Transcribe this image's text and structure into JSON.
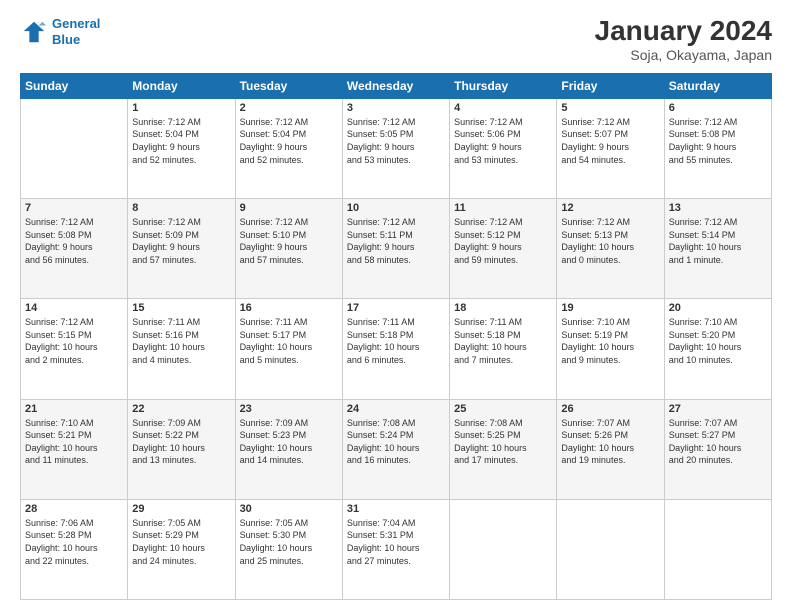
{
  "logo": {
    "line1": "General",
    "line2": "Blue"
  },
  "title": "January 2024",
  "subtitle": "Soja, Okayama, Japan",
  "headers": [
    "Sunday",
    "Monday",
    "Tuesday",
    "Wednesday",
    "Thursday",
    "Friday",
    "Saturday"
  ],
  "weeks": [
    [
      {
        "day": "",
        "info": ""
      },
      {
        "day": "1",
        "info": "Sunrise: 7:12 AM\nSunset: 5:04 PM\nDaylight: 9 hours\nand 52 minutes."
      },
      {
        "day": "2",
        "info": "Sunrise: 7:12 AM\nSunset: 5:04 PM\nDaylight: 9 hours\nand 52 minutes."
      },
      {
        "day": "3",
        "info": "Sunrise: 7:12 AM\nSunset: 5:05 PM\nDaylight: 9 hours\nand 53 minutes."
      },
      {
        "day": "4",
        "info": "Sunrise: 7:12 AM\nSunset: 5:06 PM\nDaylight: 9 hours\nand 53 minutes."
      },
      {
        "day": "5",
        "info": "Sunrise: 7:12 AM\nSunset: 5:07 PM\nDaylight: 9 hours\nand 54 minutes."
      },
      {
        "day": "6",
        "info": "Sunrise: 7:12 AM\nSunset: 5:08 PM\nDaylight: 9 hours\nand 55 minutes."
      }
    ],
    [
      {
        "day": "7",
        "info": "Sunrise: 7:12 AM\nSunset: 5:08 PM\nDaylight: 9 hours\nand 56 minutes."
      },
      {
        "day": "8",
        "info": "Sunrise: 7:12 AM\nSunset: 5:09 PM\nDaylight: 9 hours\nand 57 minutes."
      },
      {
        "day": "9",
        "info": "Sunrise: 7:12 AM\nSunset: 5:10 PM\nDaylight: 9 hours\nand 57 minutes."
      },
      {
        "day": "10",
        "info": "Sunrise: 7:12 AM\nSunset: 5:11 PM\nDaylight: 9 hours\nand 58 minutes."
      },
      {
        "day": "11",
        "info": "Sunrise: 7:12 AM\nSunset: 5:12 PM\nDaylight: 9 hours\nand 59 minutes."
      },
      {
        "day": "12",
        "info": "Sunrise: 7:12 AM\nSunset: 5:13 PM\nDaylight: 10 hours\nand 0 minutes."
      },
      {
        "day": "13",
        "info": "Sunrise: 7:12 AM\nSunset: 5:14 PM\nDaylight: 10 hours\nand 1 minute."
      }
    ],
    [
      {
        "day": "14",
        "info": "Sunrise: 7:12 AM\nSunset: 5:15 PM\nDaylight: 10 hours\nand 2 minutes."
      },
      {
        "day": "15",
        "info": "Sunrise: 7:11 AM\nSunset: 5:16 PM\nDaylight: 10 hours\nand 4 minutes."
      },
      {
        "day": "16",
        "info": "Sunrise: 7:11 AM\nSunset: 5:17 PM\nDaylight: 10 hours\nand 5 minutes."
      },
      {
        "day": "17",
        "info": "Sunrise: 7:11 AM\nSunset: 5:18 PM\nDaylight: 10 hours\nand 6 minutes."
      },
      {
        "day": "18",
        "info": "Sunrise: 7:11 AM\nSunset: 5:18 PM\nDaylight: 10 hours\nand 7 minutes."
      },
      {
        "day": "19",
        "info": "Sunrise: 7:10 AM\nSunset: 5:19 PM\nDaylight: 10 hours\nand 9 minutes."
      },
      {
        "day": "20",
        "info": "Sunrise: 7:10 AM\nSunset: 5:20 PM\nDaylight: 10 hours\nand 10 minutes."
      }
    ],
    [
      {
        "day": "21",
        "info": "Sunrise: 7:10 AM\nSunset: 5:21 PM\nDaylight: 10 hours\nand 11 minutes."
      },
      {
        "day": "22",
        "info": "Sunrise: 7:09 AM\nSunset: 5:22 PM\nDaylight: 10 hours\nand 13 minutes."
      },
      {
        "day": "23",
        "info": "Sunrise: 7:09 AM\nSunset: 5:23 PM\nDaylight: 10 hours\nand 14 minutes."
      },
      {
        "day": "24",
        "info": "Sunrise: 7:08 AM\nSunset: 5:24 PM\nDaylight: 10 hours\nand 16 minutes."
      },
      {
        "day": "25",
        "info": "Sunrise: 7:08 AM\nSunset: 5:25 PM\nDaylight: 10 hours\nand 17 minutes."
      },
      {
        "day": "26",
        "info": "Sunrise: 7:07 AM\nSunset: 5:26 PM\nDaylight: 10 hours\nand 19 minutes."
      },
      {
        "day": "27",
        "info": "Sunrise: 7:07 AM\nSunset: 5:27 PM\nDaylight: 10 hours\nand 20 minutes."
      }
    ],
    [
      {
        "day": "28",
        "info": "Sunrise: 7:06 AM\nSunset: 5:28 PM\nDaylight: 10 hours\nand 22 minutes."
      },
      {
        "day": "29",
        "info": "Sunrise: 7:05 AM\nSunset: 5:29 PM\nDaylight: 10 hours\nand 24 minutes."
      },
      {
        "day": "30",
        "info": "Sunrise: 7:05 AM\nSunset: 5:30 PM\nDaylight: 10 hours\nand 25 minutes."
      },
      {
        "day": "31",
        "info": "Sunrise: 7:04 AM\nSunset: 5:31 PM\nDaylight: 10 hours\nand 27 minutes."
      },
      {
        "day": "",
        "info": ""
      },
      {
        "day": "",
        "info": ""
      },
      {
        "day": "",
        "info": ""
      }
    ]
  ]
}
